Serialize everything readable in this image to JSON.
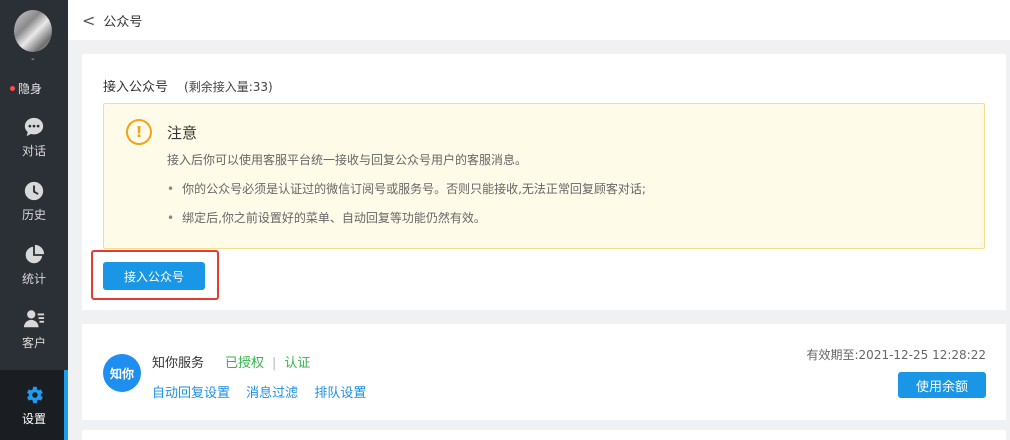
{
  "sidebar": {
    "avatar_mark": "-",
    "status_label": "隐身",
    "items": [
      {
        "label": "对话",
        "icon": "chat-icon"
      },
      {
        "label": "历史",
        "icon": "clock-icon"
      },
      {
        "label": "统计",
        "icon": "pie-chart-icon"
      },
      {
        "label": "客户",
        "icon": "customer-icon"
      },
      {
        "label": "设置",
        "icon": "gear-icon"
      }
    ],
    "active_index": 4
  },
  "header": {
    "back_glyph": "<",
    "title": "公众号"
  },
  "connect": {
    "title": "接入公众号",
    "remaining": "(剩余接入量:33)",
    "button_label": "接入公众号"
  },
  "notice": {
    "icon_glyph": "!",
    "title": "注意",
    "intro": "接入后你可以使用客服平台统一接收与回复公众号用户的客服消息。",
    "bullets": [
      "你的公众号必须是认证过的微信订阅号或服务号。否则只能接收,无法正常回复顾客对话;",
      "绑定后,你之前设置好的菜单、自动回复等功能仍然有效。"
    ]
  },
  "account": {
    "logo_text": "知你",
    "name": "知你服务",
    "authorized": "已授权",
    "separator": "|",
    "certified": "认证",
    "links": [
      "自动回复设置",
      "消息过滤",
      "排队设置"
    ],
    "expire": "有效期至:2021-12-25 12:28:22",
    "balance_button": "使用余额"
  },
  "colors": {
    "sidebar_bg": "#2b2f36",
    "accent": "#1a96e6",
    "success": "#36b34a",
    "warning": "#f0a31c",
    "highlight_border": "#e53935"
  }
}
